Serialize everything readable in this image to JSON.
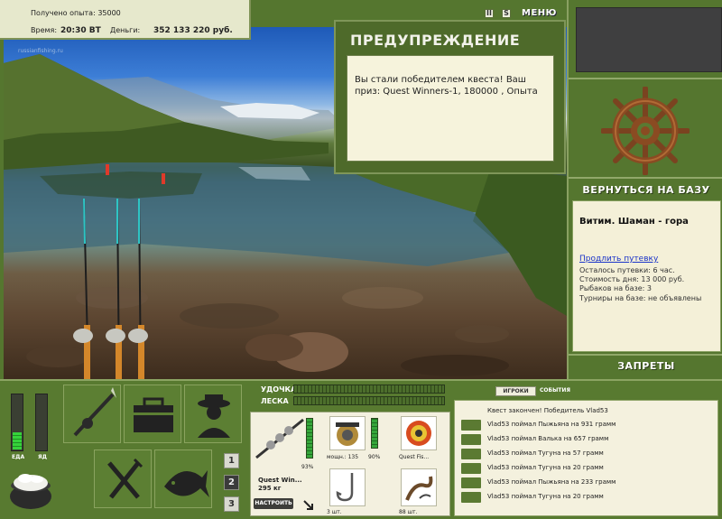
{
  "info": {
    "experience_text": "Получено опыта: 35000",
    "time_label": "Время:",
    "time_value": "20:30 ВТ",
    "money_label": "Деньги:",
    "money_value": "352 133 220 руб."
  },
  "scene": {
    "watermark": "russianfishing.ru"
  },
  "topbar": {
    "pause_icon": "II",
    "sound_icon": "S",
    "menu_label": "МЕНЮ"
  },
  "warning": {
    "title": "ПРЕДУПРЕЖДЕНИЕ",
    "message": "Вы стали победителем квеста! Ваш приз: Quest Winners-1, 180000 , Опыта"
  },
  "right": {
    "back_to_base": "ВЕРНУТЬСЯ НА БАЗУ",
    "base_name": "Витим. Шаман - гора",
    "extend_link": "Продлить путевку",
    "trip_left": "Осталось путевки: 6 час.",
    "day_cost": "Стоимость дня: 13 000 руб.",
    "fishers": "Рыбаков на базе: 3",
    "tournaments": "Турниры на базе: не объявлены",
    "restrictions": "ЗАПРЕТЫ"
  },
  "needs": {
    "food_label": "ЕДА",
    "poison_label": "ЯД",
    "food_level": 0.3,
    "poison_level": 0.0
  },
  "pages": [
    "1",
    "2",
    "3"
  ],
  "tackle": {
    "rod_label": "УДОЧКА",
    "line_label": "ЛЕСКА",
    "rod_name": "Quest Win...",
    "rod_weight": "295 кг",
    "rod_percent": "93%",
    "reel_power": "мощн.: 135",
    "reel_percent": "90%",
    "line_name": "Quest Fis...",
    "hook_count": "3 шт.",
    "bait_count": "88 шт.",
    "setup_button": "НАСТРОИТЬ"
  },
  "events": {
    "tab_players": "ИГРОКИ",
    "tab_events": "СОБЫТИЯ",
    "header": "Квест закончен! Победитель Vlad53",
    "items": [
      "Vlad53 поймал Пыжьяна на 931 грамм",
      "Vlad53 поймал Валька на 657 грамм",
      "Vlad53 поймал Тугуна на 57 грамм",
      "Vlad53 поймал Тугуна на 20 грамм",
      "Vlad53 поймал Пыжьяна на 233 грамм",
      "Vlad53 поймал Тугуна на 20 грамм"
    ]
  }
}
